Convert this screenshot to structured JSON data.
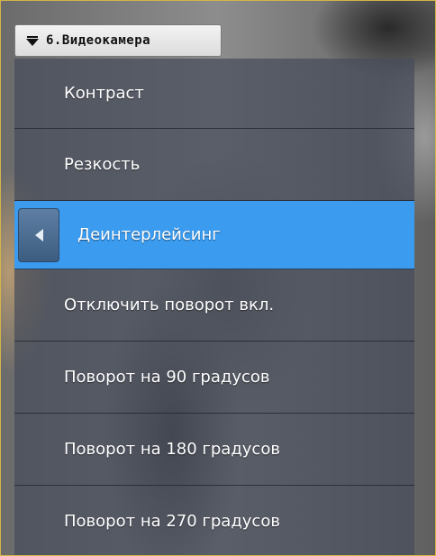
{
  "camera_selector": {
    "label": "6.Видеокамера",
    "icon": "collapse-arrow-icon"
  },
  "menu": {
    "back_icon": "chevron-left-icon",
    "selected_color": "#3a9bef",
    "items": [
      {
        "label": "Контраст",
        "selected": false
      },
      {
        "label": "Резкость",
        "selected": false
      },
      {
        "label": "Деинтерлейсинг",
        "selected": true
      },
      {
        "label": "Отключить поворот вкл.",
        "selected": false
      },
      {
        "label": "Поворот на 90 градусов",
        "selected": false
      },
      {
        "label": "Поворот на 180 градусов",
        "selected": false
      },
      {
        "label": "Поворот на 270 градусов",
        "selected": false
      }
    ]
  }
}
